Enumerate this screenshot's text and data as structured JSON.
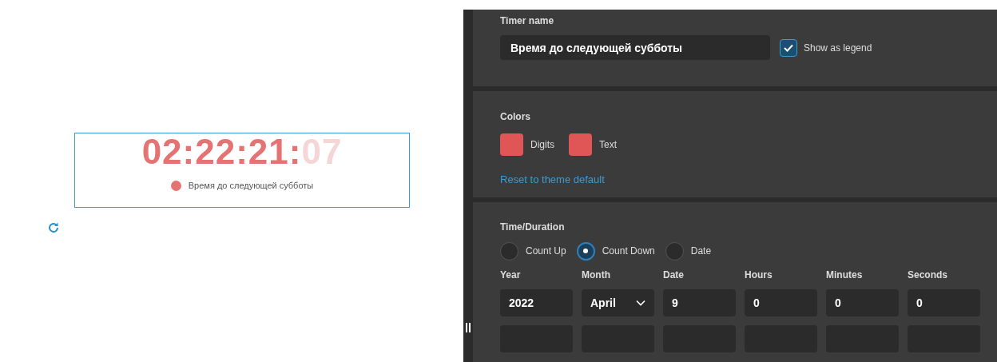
{
  "preview": {
    "digits": [
      {
        "text": "02:22:21:",
        "faded": false
      },
      {
        "text": "07",
        "faded": true
      }
    ],
    "legend": {
      "text": "Время до следующей субботы",
      "color": "#e57373"
    }
  },
  "timer_name": {
    "label": "Timer name",
    "value": "Время до следующей субботы",
    "show_as_legend": {
      "label": "Show as legend",
      "checked": true
    }
  },
  "colors": {
    "label": "Colors",
    "swatches": [
      {
        "label": "Digits",
        "color": "#e05555"
      },
      {
        "label": "Text",
        "color": "#e05555"
      }
    ],
    "reset_link": "Reset to theme default"
  },
  "time_duration": {
    "label": "Time/Duration",
    "modes": [
      {
        "label": "Count Up",
        "selected": false
      },
      {
        "label": "Count Down",
        "selected": true
      },
      {
        "label": "Date",
        "selected": false
      }
    ],
    "fields": [
      {
        "label": "Year",
        "value": "2022",
        "kind": "input"
      },
      {
        "label": "Month",
        "value": "April",
        "kind": "select"
      },
      {
        "label": "Date",
        "value": "9",
        "kind": "input"
      },
      {
        "label": "Hours",
        "value": "0",
        "kind": "input"
      },
      {
        "label": "Minutes",
        "value": "0",
        "kind": "input"
      },
      {
        "label": "Seconds",
        "value": "0",
        "kind": "input"
      }
    ]
  }
}
